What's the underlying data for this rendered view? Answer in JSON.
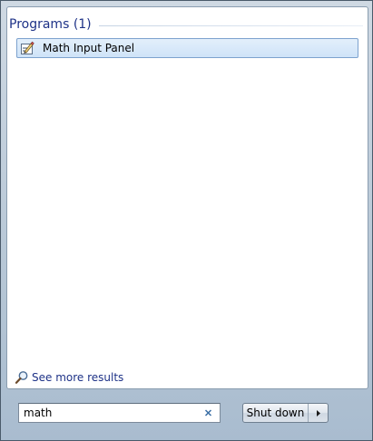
{
  "results": {
    "group_title": "Programs (1)",
    "items": [
      {
        "label": "Math Input Panel",
        "icon": "math-input-panel-icon"
      }
    ],
    "see_more_label": "See more results",
    "see_more_icon": "magnifier-icon"
  },
  "search": {
    "value": "math",
    "clear_icon": "clear-x-icon"
  },
  "shutdown": {
    "label": "Shut down",
    "arrow_icon": "triangle-right-icon"
  },
  "colors": {
    "link_blue": "#1e3287",
    "selection_border": "#7da2ce",
    "selection_fill": "#cfe3f8",
    "clear_x": "#3a6ea5"
  }
}
